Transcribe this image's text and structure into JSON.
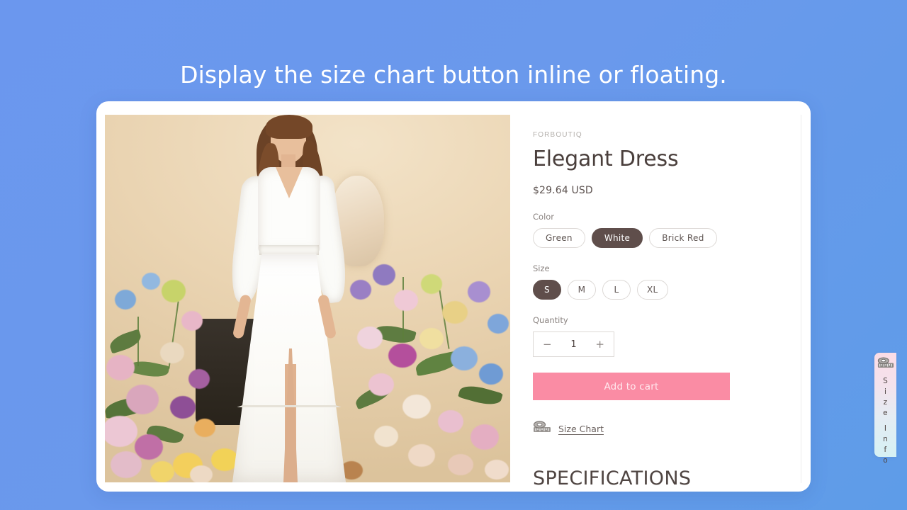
{
  "headline": "Display the size chart button inline or floating.",
  "product": {
    "vendor": "FORBOUTIQ",
    "title": "Elegant Dress",
    "price": "$29.64 USD",
    "options": [
      {
        "label": "Color",
        "name": "color",
        "values": [
          {
            "label": "Green",
            "selected": false
          },
          {
            "label": "White",
            "selected": true
          },
          {
            "label": "Brick Red",
            "selected": false
          }
        ]
      },
      {
        "label": "Size",
        "name": "size",
        "values": [
          {
            "label": "S",
            "selected": true
          },
          {
            "label": "M",
            "selected": false
          },
          {
            "label": "L",
            "selected": false
          },
          {
            "label": "XL",
            "selected": false
          }
        ]
      }
    ],
    "quantity": {
      "label": "Quantity",
      "decrease": "−",
      "value": "1",
      "increase": "+"
    },
    "add_to_cart": "Add to cart",
    "size_chart_link": {
      "text": "Size Chart",
      "icon": "measuring-tape-icon"
    },
    "specifications_heading": "SPECIFICATIONS"
  },
  "floating_tab": {
    "icon": "measuring-tape-icon",
    "line1": "Size",
    "line2": "Info",
    "letters_line1": [
      "S",
      "i",
      "z",
      "e"
    ],
    "letters_line2": [
      "I",
      "n",
      "f",
      "o"
    ]
  },
  "colors": {
    "background_start": "#6B97EE",
    "background_end": "#5E9CE8",
    "accent_pink": "#FA8CA4",
    "selected_swatch": "#5F4E4B",
    "text_dark": "#4A3F3C",
    "tab_gradient_start": "#FBDCE6",
    "tab_gradient_end": "#D5F1F4"
  }
}
